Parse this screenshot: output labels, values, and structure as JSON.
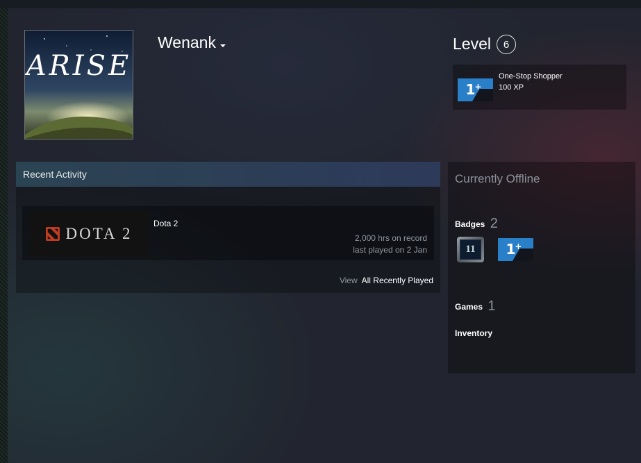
{
  "profile": {
    "persona_name": "Wenank",
    "avatar_text": "Arise"
  },
  "level": {
    "label": "Level",
    "value": "6"
  },
  "favorite_badge": {
    "icon": "one-plus-badge",
    "name": "One-Stop Shopper",
    "xp": "100 XP"
  },
  "recent_activity": {
    "header": "Recent Activity",
    "game": {
      "capsule_wordmark": "DOTA 2",
      "name": "Dota 2",
      "hours": "2,000 hrs on record",
      "last_played": "last played on 2 Jan"
    },
    "view_label": "View",
    "view_link": "All Recently Played"
  },
  "sidebar": {
    "status": "Currently Offline",
    "badges_label": "Badges",
    "badges_count": "2",
    "badge_years_value": "11",
    "games_label": "Games",
    "games_count": "1",
    "inventory_label": "Inventory"
  },
  "colors": {
    "badge_blue": "#2a7fc9",
    "accent_header": "#2b4453",
    "background": "#22252f"
  }
}
